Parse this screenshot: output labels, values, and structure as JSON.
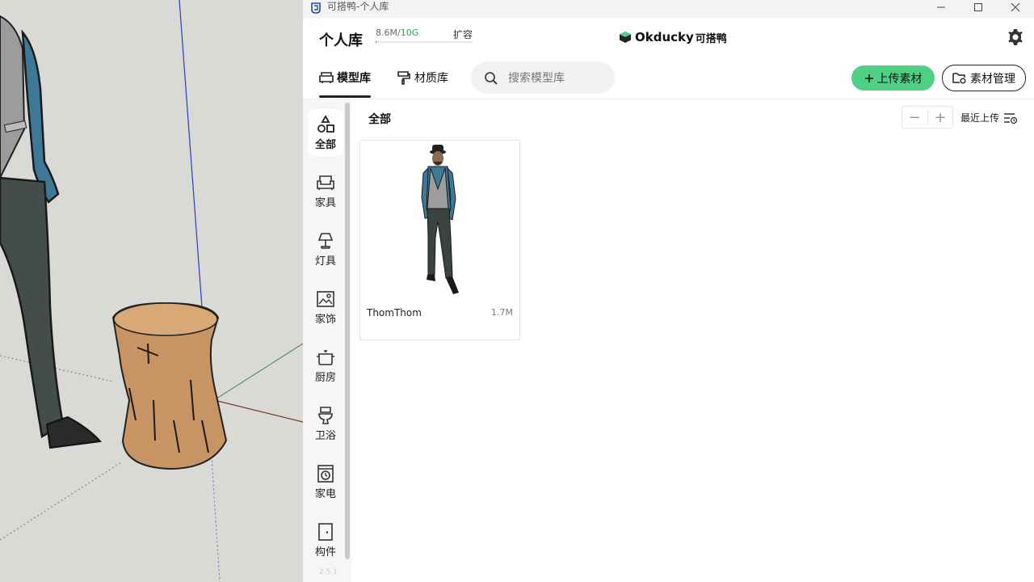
{
  "window": {
    "title": "可搭鸭-个人库"
  },
  "header": {
    "title": "个人库",
    "storage_used": "8.6M",
    "storage_sep": "/",
    "storage_total": "10G",
    "storage_fraction": 0.001,
    "expand_label": "扩容",
    "brand_name": "Okducky",
    "brand_cn": "可搭鸭"
  },
  "toolbar": {
    "tabs": [
      {
        "label": "模型库"
      },
      {
        "label": "材质库"
      }
    ],
    "search_placeholder": "搜索模型库",
    "upload_label": "上传素材",
    "manage_label": "素材管理"
  },
  "sidebar": {
    "categories": [
      {
        "label": "全部",
        "icon": "shapes-icon"
      },
      {
        "label": "家具",
        "icon": "sofa-icon"
      },
      {
        "label": "灯具",
        "icon": "lamp-icon"
      },
      {
        "label": "家饰",
        "icon": "picture-icon"
      },
      {
        "label": "厨房",
        "icon": "pot-icon"
      },
      {
        "label": "卫浴",
        "icon": "toilet-icon"
      },
      {
        "label": "家电",
        "icon": "washer-icon"
      },
      {
        "label": "构件",
        "icon": "door-icon"
      }
    ],
    "version": "2.5.1"
  },
  "content": {
    "section_title": "全部",
    "zoom_out": "−",
    "zoom_in": "+",
    "sort_label": "最近上传",
    "items": [
      {
        "name": "ThomThom",
        "size": "1.7M"
      }
    ]
  },
  "colors": {
    "accent": "#4fd084",
    "storage": "#26a65b"
  }
}
